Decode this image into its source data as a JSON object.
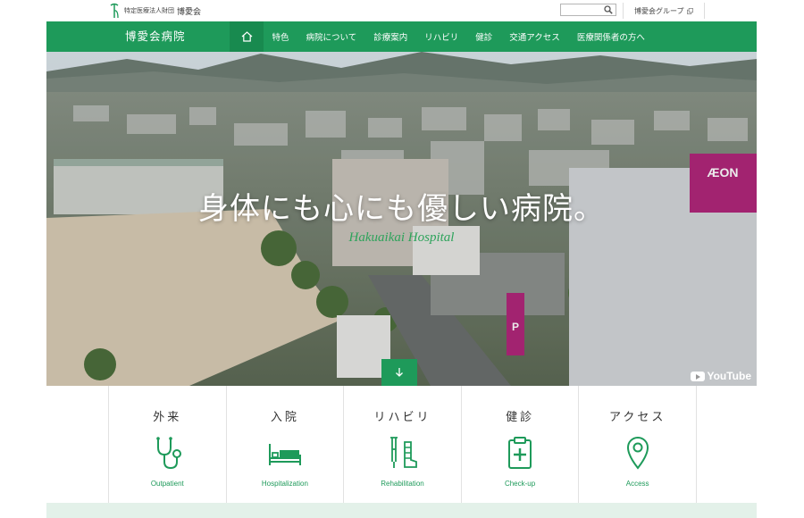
{
  "header": {
    "logo_sub": "特定医療法人財団",
    "logo_main": "博愛会",
    "search_placeholder": "",
    "group_link": "博愛会グループ"
  },
  "nav": {
    "brand": "博愛会病院",
    "items": [
      "特色",
      "病院について",
      "診療案内",
      "リハビリ",
      "健診",
      "交通アクセス",
      "医療関係者の方へ"
    ]
  },
  "hero": {
    "title": "身体にも心にも優しい病院。",
    "subtitle": "Hakuaikai Hospital",
    "video_badge": "YouTube",
    "signs": {
      "store": "ÆON",
      "parking": "P"
    }
  },
  "cards": [
    {
      "title": "外来",
      "en": "Outpatient",
      "icon": "stethoscope-icon"
    },
    {
      "title": "入院",
      "en": "Hospitalization",
      "icon": "hospital-bed-icon"
    },
    {
      "title": "リハビリ",
      "en": "Rehabilitation",
      "icon": "crutch-icon"
    },
    {
      "title": "健診",
      "en": "Check-up",
      "icon": "clipboard-icon"
    },
    {
      "title": "アクセス",
      "en": "Access",
      "icon": "map-pin-icon"
    }
  ],
  "colors": {
    "brand_green": "#1e9a5a",
    "band": "#e3f1e9"
  }
}
